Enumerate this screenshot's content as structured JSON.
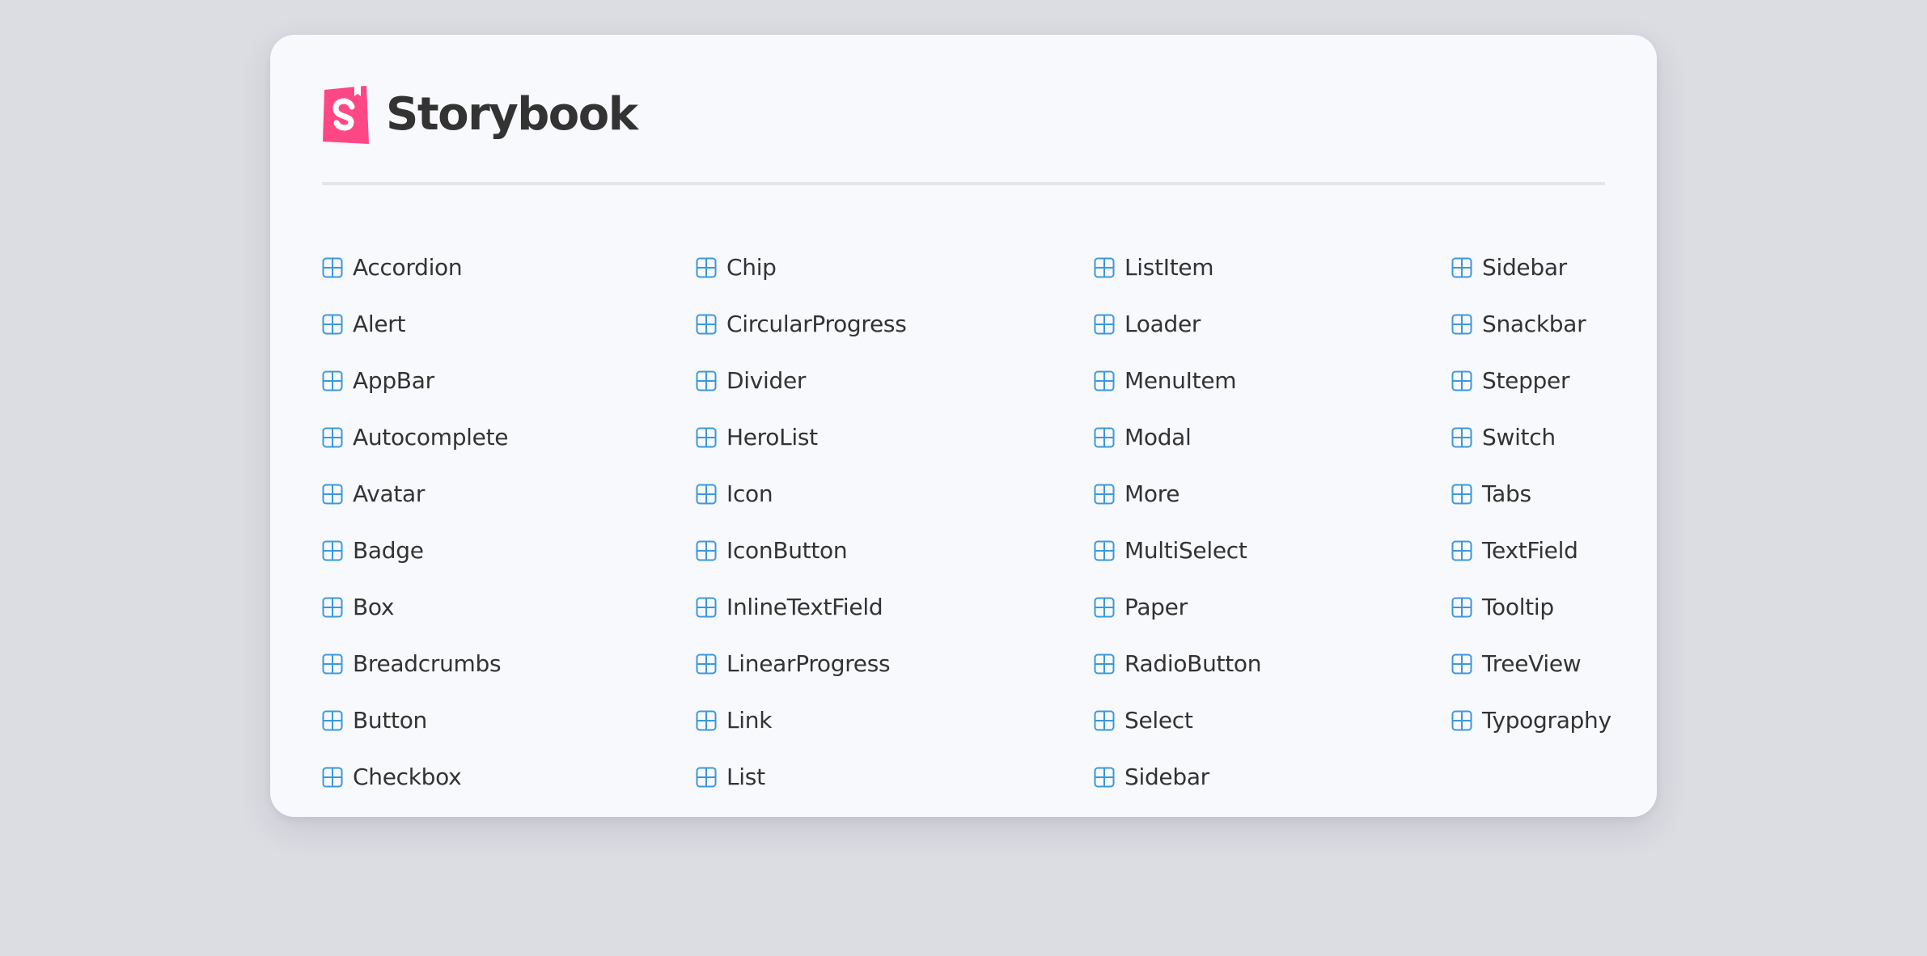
{
  "app": {
    "title": "Storybook",
    "logo_icon": "storybook-logo-icon",
    "brand_color": "#ff4785",
    "text_color": "#333333",
    "accent_color": "#3b98dc",
    "component_icon": "component-grid-icon"
  },
  "columns": [
    {
      "items": [
        {
          "label": "Accordion"
        },
        {
          "label": "Alert"
        },
        {
          "label": "AppBar"
        },
        {
          "label": "Autocomplete"
        },
        {
          "label": "Avatar"
        },
        {
          "label": "Badge"
        },
        {
          "label": "Box"
        },
        {
          "label": "Breadcrumbs"
        },
        {
          "label": "Button"
        },
        {
          "label": "Checkbox"
        }
      ]
    },
    {
      "items": [
        {
          "label": "Chip"
        },
        {
          "label": "CircularProgress"
        },
        {
          "label": "Divider"
        },
        {
          "label": "HeroList"
        },
        {
          "label": "Icon"
        },
        {
          "label": "IconButton"
        },
        {
          "label": "InlineTextField"
        },
        {
          "label": "LinearProgress"
        },
        {
          "label": "Link"
        },
        {
          "label": "List"
        }
      ]
    },
    {
      "items": [
        {
          "label": "ListItem"
        },
        {
          "label": "Loader"
        },
        {
          "label": "MenuItem"
        },
        {
          "label": "Modal"
        },
        {
          "label": "More"
        },
        {
          "label": "MultiSelect"
        },
        {
          "label": "Paper"
        },
        {
          "label": "RadioButton"
        },
        {
          "label": "Select"
        },
        {
          "label": "Sidebar"
        }
      ]
    },
    {
      "items": [
        {
          "label": "Sidebar"
        },
        {
          "label": "Snackbar"
        },
        {
          "label": "Stepper"
        },
        {
          "label": "Switch"
        },
        {
          "label": "Tabs"
        },
        {
          "label": "TextField"
        },
        {
          "label": "Tooltip"
        },
        {
          "label": "TreeView"
        },
        {
          "label": "Typography"
        }
      ]
    }
  ]
}
